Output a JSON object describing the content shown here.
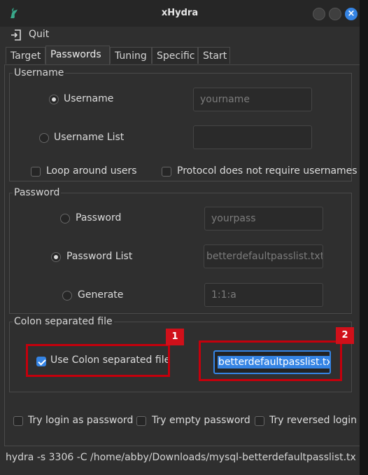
{
  "window": {
    "title": "xHydra"
  },
  "menu": {
    "quit_label": "Quit"
  },
  "tabs": [
    {
      "label": "Target"
    },
    {
      "label": "Passwords",
      "active": true
    },
    {
      "label": "Tuning"
    },
    {
      "label": "Specific"
    },
    {
      "label": "Start"
    }
  ],
  "username_group": {
    "title": "Username",
    "username_label": "Username",
    "username_selected": true,
    "username_placeholder": "yourname",
    "username_list_label": "Username List",
    "username_list_value": "",
    "loop_around_users_label": "Loop around users",
    "loop_around_users_checked": false,
    "no_usernames_label": "Protocol does not require usernames",
    "no_usernames_checked": false
  },
  "password_group": {
    "title": "Password",
    "password_label": "Password",
    "password_placeholder": "yourpass",
    "password_list_label": "Password List",
    "password_list_selected": true,
    "password_list_value": "betterdefaultpasslist.txt",
    "generate_label": "Generate",
    "generate_value": "1:1:a"
  },
  "colon_group": {
    "title": "Colon separated file",
    "use_colon_label": "Use Colon separated file",
    "use_colon_checked": true,
    "file_value": "betterdefaultpasslist.txt"
  },
  "options": {
    "try_login_label": "Try login as password",
    "try_empty_label": "Try empty password",
    "try_reversed_label": "Try reversed login"
  },
  "annotations": {
    "badge1": "1",
    "badge2": "2",
    "highlight_color": "#c4000c"
  },
  "statusbar": {
    "command": "hydra -s 3306 -C /home/abby/Downloads/mysql-betterdefaultpasslist.tx…"
  },
  "colors": {
    "accent": "#3584e4",
    "background": "#2f2f2f"
  }
}
